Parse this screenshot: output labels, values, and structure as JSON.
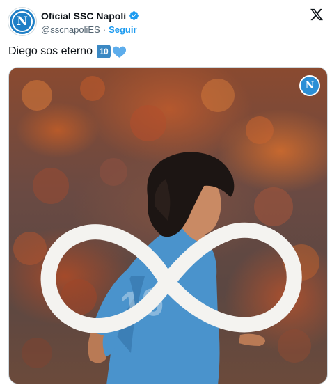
{
  "account": {
    "display_name": "Oficial SSC Napoli",
    "handle": "@sscnapoliES",
    "separator": "·",
    "follow_label": "Seguir",
    "avatar_letter": "N",
    "verified_color": "#1d9bf0",
    "avatar_color": "#1f7fc6"
  },
  "platform": {
    "logo_icon": "x-logo-icon"
  },
  "tweet": {
    "text": "Diego sos eterno",
    "emoji_keycap": "10",
    "emoji_heart_color": "#5dadec"
  },
  "media": {
    "badge_letter": "N",
    "jersey_number": "10",
    "icons": [
      "infinity-symbol",
      "napoli-badge-icon"
    ]
  },
  "colors": {
    "text": "#0f1419",
    "secondary": "#536471",
    "link": "#1d9bf0",
    "jersey": "#4a93cc"
  }
}
